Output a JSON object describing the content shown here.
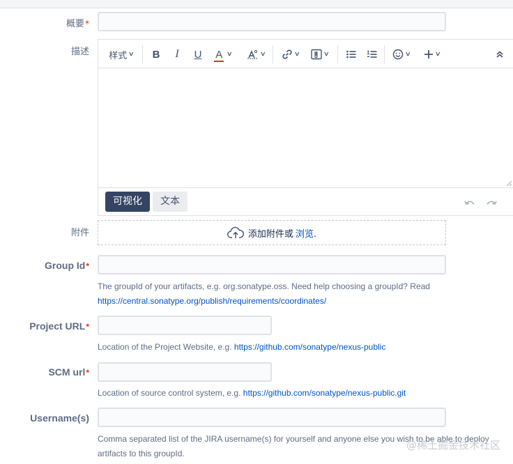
{
  "fields": {
    "summary": {
      "label": "概要",
      "required": "*"
    },
    "description": {
      "label": "描述"
    },
    "attachment": {
      "label": "附件",
      "text": "添加附件或",
      "browse": "浏览."
    },
    "group_id": {
      "label": "Group Id",
      "required": "*",
      "help_text": "The groupId of your artifacts, e.g. org.sonatype.oss. Need help choosing a groupId? Read",
      "help_link": "https://central.sonatype.org/publish/requirements/coordinates/"
    },
    "project_url": {
      "label": "Project URL",
      "required": "*",
      "help_text": "Location of the Project Website, e.g. ",
      "help_link": "https://github.com/sonatype/nexus-public"
    },
    "scm_url": {
      "label": "SCM url",
      "required": "*",
      "help_text": "Location of source control system, e.g. ",
      "help_link": "https://github.com/sonatype/nexus-public.git"
    },
    "usernames": {
      "label": "Username(s)",
      "help_line1": "Comma separated list of the JIRA username(s) for yourself and anyone else you wish to be able to deploy",
      "help_line2": "artifacts to this groupId."
    }
  },
  "editor": {
    "toolbar": {
      "style_label": "样式",
      "bold": "B",
      "italic": "I",
      "underline": "U",
      "text_color": "A",
      "icons": [
        "chevron-down-icon",
        "text-effects-icon",
        "link-icon",
        "attachment-icon",
        "bullet-list-icon",
        "numbered-list-icon",
        "emoji-icon",
        "plus-icon",
        "collapse-icon"
      ]
    },
    "modes": {
      "visual": "可视化",
      "text": "文本"
    }
  },
  "watermark": "@稀土掘金技术社区",
  "colors": {
    "accent": "#0052cc",
    "required": "#de350b",
    "text_color_bar": "#de350b",
    "active_mode": "#344563"
  }
}
